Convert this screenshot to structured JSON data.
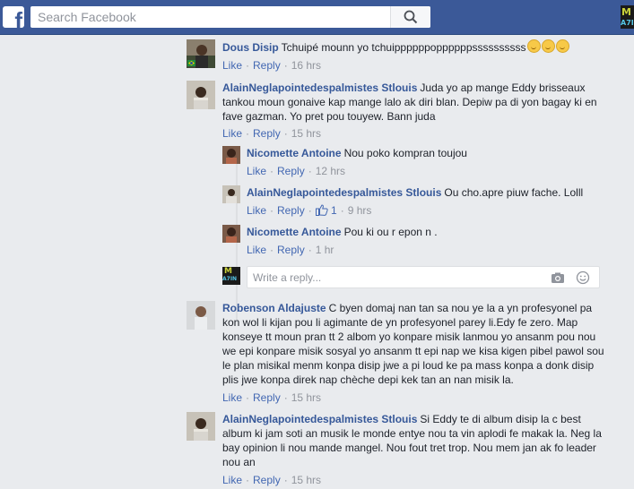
{
  "header": {
    "logo_letter": "f",
    "search_placeholder": "Search Facebook",
    "corner_thumb_top": "M",
    "corner_thumb_bottom": "A7IN"
  },
  "reply_box": {
    "placeholder": "Write a reply..."
  },
  "reply_avatar": {
    "top": "M",
    "bottom": "A7IN"
  },
  "actions": {
    "like": "Like",
    "reply": "Reply",
    "dot": "·"
  },
  "comments": [
    {
      "author": "Dous Disip",
      "text": "Tchuipé mounn yo tchuippppppoppppppssssssssss",
      "emoji_count": 3,
      "time": "16 hrs"
    },
    {
      "author": "AlainNeglapointedespalmistes Stlouis",
      "text": "Juda yo ap mange Eddy brisseaux tankou moun gonaive kap mange lalo ak diri blan. Depiw pa di yon bagay ki en fave gazman. Yo pret pou touyew. Bann juda",
      "time": "15 hrs"
    },
    {
      "author": "Nicomette Antoine",
      "text": "Nou poko kompran toujou",
      "time": "12 hrs"
    },
    {
      "author": "AlainNeglapointedespalmistes Stlouis",
      "text": "Ou cho.apre piuw fache. Lolll",
      "likes": "1",
      "time": "9 hrs"
    },
    {
      "author": "Nicomette Antoine",
      "text": "Pou ki ou r epon n .",
      "time": "1 hr"
    },
    {
      "author": "Robenson Aldajuste",
      "text": "C byen domaj nan tan sa nou ye la a yn profesyonel pa kon wol li kijan pou li agimante de yn profesyonel parey li.Edy fe zero. Map konseye tt moun pran tt 2 albom yo konpare misik lanmou yo ansanm pou nou we epi konpare misik sosyal yo ansanm tt epi nap we kisa kigen pibel pawol sou le plan misikal menm konpa disip jwe a pi loud ke pa mass konpa a donk disip plis jwe konpa direk nap chèche depi kek tan an nan misik la.",
      "time": "15 hrs"
    },
    {
      "author": "AlainNeglapointedespalmistes Stlouis",
      "text": "Si Eddy te di album disip la c best album ki jam soti an musik le monde entye nou ta vin aplodi fe makak la. Neg la bay opinion li nou mande mangel. Nou fout tret trop. Nou mem jan ak fo leader nou an",
      "time": "15 hrs"
    }
  ],
  "colors": {
    "brand": "#3b5998",
    "link": "#365899",
    "action": "#4267b2",
    "meta": "#90949c",
    "background": "#e9ebee"
  }
}
